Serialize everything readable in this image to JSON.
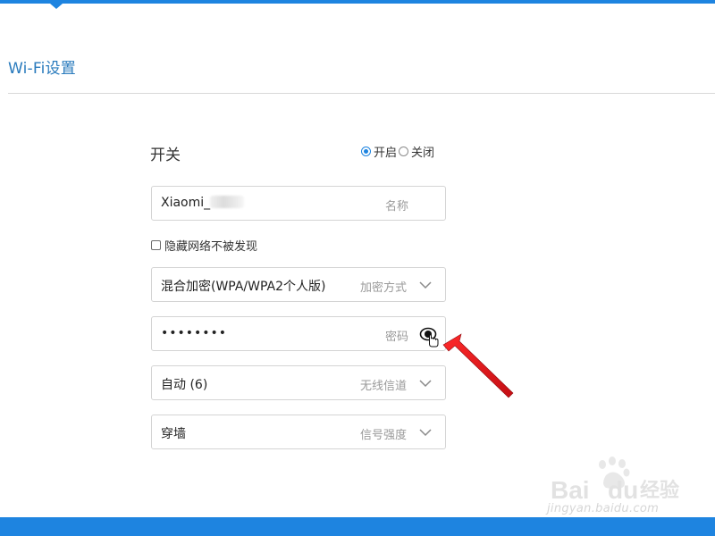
{
  "page": {
    "title": "Wi-Fi设置"
  },
  "switch": {
    "label": "开关",
    "options": [
      {
        "label": "开启",
        "checked": true
      },
      {
        "label": "关闭",
        "checked": false
      }
    ]
  },
  "ssid": {
    "value": "Xiaomi_",
    "hint": "名称"
  },
  "hide_network": {
    "label": "隐藏网络不被发现",
    "checked": false
  },
  "encryption": {
    "value": "混合加密(WPA/WPA2个人版)",
    "hint": "加密方式"
  },
  "password": {
    "value": "••••••••",
    "hint": "密码"
  },
  "channel": {
    "value": "自动 (6)",
    "hint": "无线信道"
  },
  "signal": {
    "value": "穿墙",
    "hint": "信号强度"
  },
  "watermark": {
    "brand": "Baidu经验",
    "url": "jingyan.baidu.com"
  },
  "colors": {
    "accent": "#1e84e0",
    "title": "#2a7bbd",
    "annotation_arrow": "#e8141c"
  },
  "icons": {
    "password_toggle": "eye-icon",
    "dropdown": "chevron-down-icon",
    "cursor": "hand-pointer-icon"
  }
}
